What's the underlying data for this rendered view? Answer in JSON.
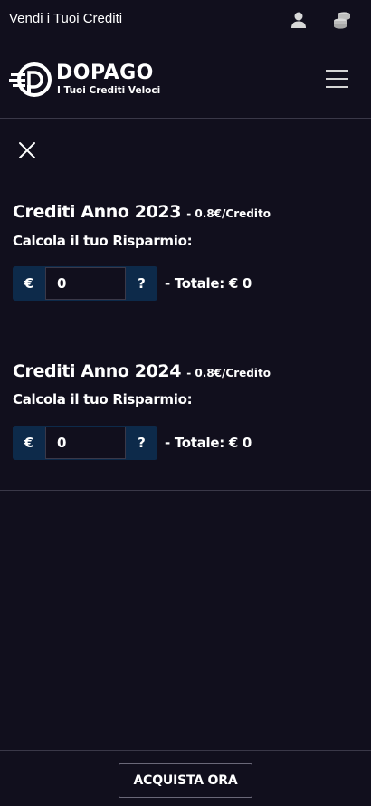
{
  "topbar": {
    "title": "Vendi i Tuoi Crediti",
    "icons": [
      "user-icon",
      "coins-icon"
    ]
  },
  "brand": {
    "name": "DOPAGO",
    "tagline": "I Tuoi Crediti Veloci"
  },
  "sections": [
    {
      "title": "Crediti Anno 2023",
      "price": "- 0.8€/Credito",
      "subtitle": "Calcola il tuo Risparmio:",
      "currency": "€",
      "input_value": "0",
      "help": "?",
      "total": "- Totale: € 0"
    },
    {
      "title": "Crediti Anno 2024",
      "price": "- 0.8€/Credito",
      "subtitle": "Calcola il tuo Risparmio:",
      "currency": "€",
      "input_value": "0",
      "help": "?",
      "total": "- Totale: € 0"
    }
  ],
  "footer": {
    "cta_label": "ACQUISTA ORA"
  },
  "colors": {
    "background": "#110f1d",
    "accent": "#0d2a4a",
    "divider": "#3a3848"
  }
}
